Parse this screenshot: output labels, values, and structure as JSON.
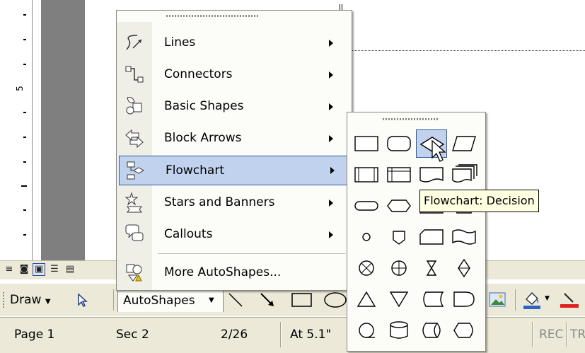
{
  "ruler": {
    "number_label": "5"
  },
  "autoshapes_menu": {
    "items": [
      {
        "label": "Lines",
        "icon": "lines-icon",
        "has_submenu": true,
        "highlighted": false
      },
      {
        "label": "Connectors",
        "icon": "connectors-icon",
        "has_submenu": true,
        "highlighted": false
      },
      {
        "label": "Basic Shapes",
        "icon": "basic-shapes-icon",
        "has_submenu": true,
        "highlighted": false
      },
      {
        "label": "Block Arrows",
        "icon": "block-arrows-icon",
        "has_submenu": true,
        "highlighted": false
      },
      {
        "label": "Flowchart",
        "icon": "flowchart-icon",
        "has_submenu": true,
        "highlighted": true
      },
      {
        "label": "Stars and Banners",
        "icon": "stars-banners-icon",
        "has_submenu": true,
        "highlighted": false
      },
      {
        "label": "Callouts",
        "icon": "callouts-icon",
        "has_submenu": true,
        "highlighted": false
      },
      {
        "label": "More AutoShapes...",
        "icon": "more-autoshapes-icon",
        "has_submenu": false,
        "highlighted": false
      }
    ]
  },
  "flowchart_palette": {
    "hovered_shape": "decision",
    "shapes": [
      "process",
      "alternate-process",
      "decision",
      "data",
      "predefined-process",
      "internal-storage",
      "document",
      "multidocument",
      "terminator",
      "preparation",
      "manual-input",
      "manual-operation",
      "connector",
      "off-page-connector",
      "card",
      "punched-tape",
      "summing-junction",
      "or",
      "collate",
      "sort",
      "extract",
      "merge",
      "stored-data",
      "delay",
      "sequential-access-storage",
      "magnetic-disk",
      "direct-access-storage",
      "display"
    ]
  },
  "tooltip": {
    "text": "Flowchart: Decision"
  },
  "drawing_toolbar": {
    "draw_label": "Draw",
    "autoshapes_label": "AutoShapes"
  },
  "status_bar": {
    "page": "Page 1",
    "section": "Sec 2",
    "page_count": "2/26",
    "at": "At 5.1\"",
    "rec": "REC",
    "trk": "TR"
  },
  "colors": {
    "menu_highlight": "#c1d2ee",
    "menu_highlight_border": "#31599c",
    "toolbar_bg": "#ece9d8",
    "tooltip_bg": "#ffffe1"
  }
}
